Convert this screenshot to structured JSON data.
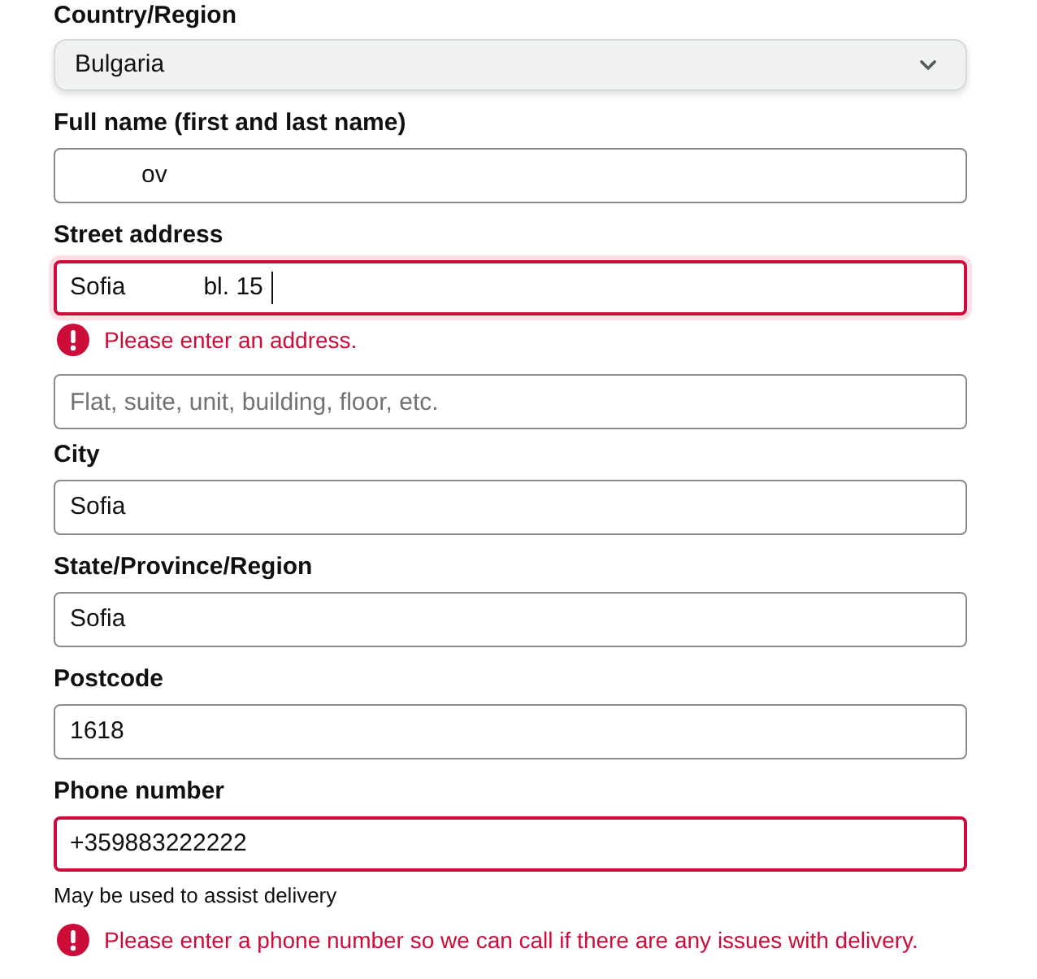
{
  "form": {
    "fields": [
      {
        "kind": "select",
        "label": "Country/Region",
        "value": "Bulgaria"
      },
      {
        "kind": "text",
        "label": "Full name (first and last name)",
        "value_parts": [
          {
            "kind": "redacted"
          },
          {
            "kind": "text",
            "text": "ov"
          }
        ],
        "invalid": false,
        "focused": false
      },
      {
        "kind": "text",
        "label": "Street address",
        "value_parts": [
          {
            "kind": "text",
            "text": "Sofia"
          },
          {
            "kind": "redacted"
          },
          {
            "kind": "text",
            "text": "bl. 15"
          }
        ],
        "invalid": true,
        "focused": true,
        "error": "Please enter an address."
      },
      {
        "kind": "text",
        "placeholder": "Flat, suite, unit, building, floor, etc.",
        "invalid": false,
        "focused": false
      },
      {
        "kind": "text",
        "label": "City",
        "value_parts": [
          {
            "kind": "text",
            "text": "Sofia"
          }
        ],
        "invalid": false,
        "focused": false
      },
      {
        "kind": "text",
        "label": "State/Province/Region",
        "value_parts": [
          {
            "kind": "text",
            "text": "Sofia"
          }
        ],
        "invalid": false,
        "focused": false
      },
      {
        "kind": "text",
        "label": "Postcode",
        "value_parts": [
          {
            "kind": "text",
            "text": "1618"
          }
        ],
        "invalid": false,
        "focused": false
      },
      {
        "kind": "text",
        "label": "Phone number",
        "value_parts": [
          {
            "kind": "text",
            "text": "+359883222222"
          }
        ],
        "invalid": true,
        "focused": false,
        "hint": "May be used to assist delivery",
        "error": "Please enter a phone number so we can call if there are any issues with delivery."
      }
    ]
  }
}
